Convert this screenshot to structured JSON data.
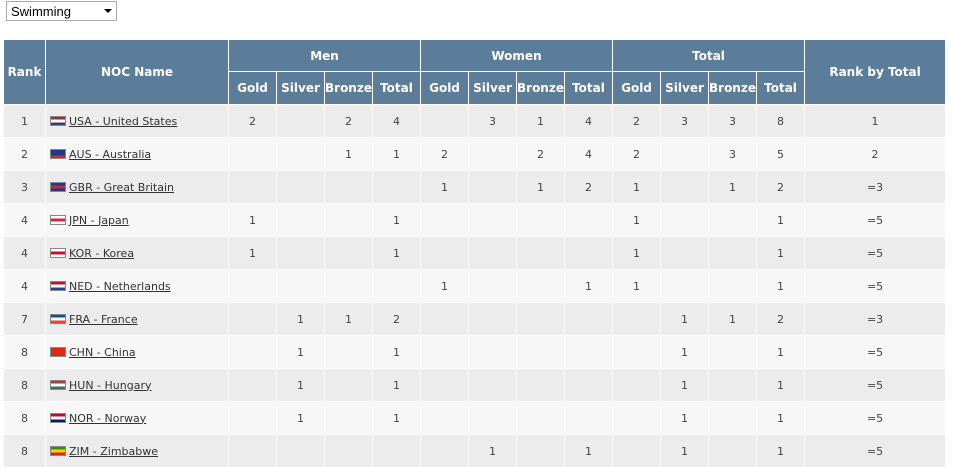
{
  "sport_select": {
    "value": "Swimming"
  },
  "headers": {
    "rank": "Rank",
    "noc_name": "NOC Name",
    "groups": [
      "Men",
      "Women",
      "Total"
    ],
    "sub": [
      "Gold",
      "Silver",
      "Bronze",
      "Total"
    ],
    "rank_by_total": "Rank by Total"
  },
  "rows": [
    {
      "rank": "1",
      "noc": "USA - United States",
      "flag_colors": [
        "#b22234",
        "#ffffff",
        "#3c3b6e"
      ],
      "men": [
        "2",
        "",
        "2",
        "4"
      ],
      "women": [
        "",
        "3",
        "1",
        "4"
      ],
      "total": [
        "2",
        "3",
        "3",
        "8"
      ],
      "rank_by_total": "1"
    },
    {
      "rank": "2",
      "noc": "AUS - Australia",
      "flag_colors": [
        "#1a3a8f",
        "#1a3a8f",
        "#cf2a2a"
      ],
      "men": [
        "",
        "",
        "1",
        "1"
      ],
      "women": [
        "2",
        "",
        "2",
        "4"
      ],
      "total": [
        "2",
        "",
        "3",
        "5"
      ],
      "rank_by_total": "2"
    },
    {
      "rank": "3",
      "noc": "GBR - Great Britain",
      "flag_colors": [
        "#1a3a8f",
        "#cf2a2a",
        "#1a3a8f"
      ],
      "men": [
        "",
        "",
        "",
        ""
      ],
      "women": [
        "1",
        "",
        "1",
        "2"
      ],
      "total": [
        "1",
        "",
        "1",
        "2"
      ],
      "rank_by_total": "=3"
    },
    {
      "rank": "4",
      "noc": "JPN - Japan",
      "flag_colors": [
        "#ffffff",
        "#d7263d",
        "#ffffff"
      ],
      "men": [
        "1",
        "",
        "",
        "1"
      ],
      "women": [
        "",
        "",
        "",
        ""
      ],
      "total": [
        "1",
        "",
        "",
        "1"
      ],
      "rank_by_total": "=5"
    },
    {
      "rank": "4",
      "noc": "KOR - Korea",
      "flag_colors": [
        "#ffffff",
        "#c8102e",
        "#ffffff"
      ],
      "men": [
        "1",
        "",
        "",
        "1"
      ],
      "women": [
        "",
        "",
        "",
        ""
      ],
      "total": [
        "1",
        "",
        "",
        "1"
      ],
      "rank_by_total": "=5"
    },
    {
      "rank": "4",
      "noc": "NED - Netherlands",
      "flag_colors": [
        "#ae1c28",
        "#ffffff",
        "#21468b"
      ],
      "men": [
        "",
        "",
        "",
        ""
      ],
      "women": [
        "1",
        "",
        "",
        "1"
      ],
      "total": [
        "1",
        "",
        "",
        "1"
      ],
      "rank_by_total": "=5"
    },
    {
      "rank": "7",
      "noc": "FRA - France",
      "flag_colors": [
        "#0055a4",
        "#ffffff",
        "#ef4135"
      ],
      "men": [
        "",
        "1",
        "1",
        "2"
      ],
      "women": [
        "",
        "",
        "",
        ""
      ],
      "total": [
        "",
        "1",
        "1",
        "2"
      ],
      "rank_by_total": "=3"
    },
    {
      "rank": "8",
      "noc": "CHN - China",
      "flag_colors": [
        "#de2910",
        "#de2910",
        "#de2910"
      ],
      "men": [
        "",
        "1",
        "",
        "1"
      ],
      "women": [
        "",
        "",
        "",
        ""
      ],
      "total": [
        "",
        "1",
        "",
        "1"
      ],
      "rank_by_total": "=5"
    },
    {
      "rank": "8",
      "noc": "HUN - Hungary",
      "flag_colors": [
        "#cd2a3e",
        "#ffffff",
        "#436f4d"
      ],
      "men": [
        "",
        "1",
        "",
        "1"
      ],
      "women": [
        "",
        "",
        "",
        ""
      ],
      "total": [
        "",
        "1",
        "",
        "1"
      ],
      "rank_by_total": "=5"
    },
    {
      "rank": "8",
      "noc": "NOR - Norway",
      "flag_colors": [
        "#ba0c2f",
        "#ffffff",
        "#00205b"
      ],
      "men": [
        "",
        "1",
        "",
        "1"
      ],
      "women": [
        "",
        "",
        "",
        ""
      ],
      "total": [
        "",
        "1",
        "",
        "1"
      ],
      "rank_by_total": "=5"
    },
    {
      "rank": "8",
      "noc": "ZIM - Zimbabwe",
      "flag_colors": [
        "#319208",
        "#ffd200",
        "#de2010"
      ],
      "men": [
        "",
        "",
        "",
        ""
      ],
      "women": [
        "",
        "1",
        "",
        "1"
      ],
      "total": [
        "",
        "1",
        "",
        "1"
      ],
      "rank_by_total": "=5"
    }
  ]
}
